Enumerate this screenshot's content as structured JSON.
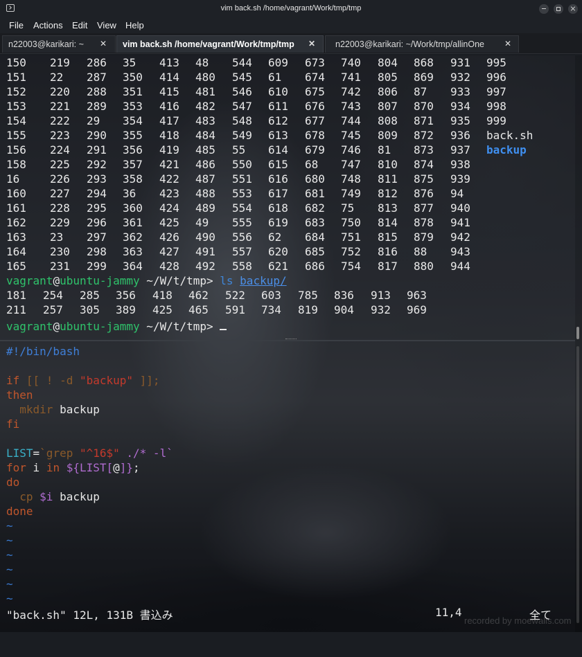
{
  "window": {
    "title": "vim back.sh /home/vagrant/Work/tmp/tmp"
  },
  "menu": [
    "File",
    "Actions",
    "Edit",
    "View",
    "Help"
  ],
  "tabs": [
    {
      "label": "n22003@karikari: ~",
      "active": false
    },
    {
      "label": "vim back.sh /home/vagrant/Work/tmp/tmp",
      "active": true
    },
    {
      "label": "n22003@karikari: ~/Work/tmp/allinOne",
      "active": false
    }
  ],
  "top_terminal": {
    "listing_rows": [
      [
        "150",
        "219",
        "286",
        "35",
        "413",
        "48",
        "544",
        "609",
        "673",
        "740",
        "804",
        "868",
        "931",
        "995"
      ],
      [
        "151",
        "22",
        "287",
        "350",
        "414",
        "480",
        "545",
        "61",
        "674",
        "741",
        "805",
        "869",
        "932",
        "996"
      ],
      [
        "152",
        "220",
        "288",
        "351",
        "415",
        "481",
        "546",
        "610",
        "675",
        "742",
        "806",
        "87",
        "933",
        "997"
      ],
      [
        "153",
        "221",
        "289",
        "353",
        "416",
        "482",
        "547",
        "611",
        "676",
        "743",
        "807",
        "870",
        "934",
        "998"
      ],
      [
        "154",
        "222",
        "29",
        "354",
        "417",
        "483",
        "548",
        "612",
        "677",
        "744",
        "808",
        "871",
        "935",
        "999"
      ],
      [
        "155",
        "223",
        "290",
        "355",
        "418",
        "484",
        "549",
        "613",
        "678",
        "745",
        "809",
        "872",
        "936",
        "back.sh"
      ],
      [
        "156",
        "224",
        "291",
        "356",
        "419",
        "485",
        "55",
        "614",
        "679",
        "746",
        "81",
        "873",
        "937",
        "backup"
      ],
      [
        "158",
        "225",
        "292",
        "357",
        "421",
        "486",
        "550",
        "615",
        "68",
        "747",
        "810",
        "874",
        "938",
        ""
      ],
      [
        "16",
        "226",
        "293",
        "358",
        "422",
        "487",
        "551",
        "616",
        "680",
        "748",
        "811",
        "875",
        "939",
        ""
      ],
      [
        "160",
        "227",
        "294",
        "36",
        "423",
        "488",
        "553",
        "617",
        "681",
        "749",
        "812",
        "876",
        "94",
        ""
      ],
      [
        "161",
        "228",
        "295",
        "360",
        "424",
        "489",
        "554",
        "618",
        "682",
        "75",
        "813",
        "877",
        "940",
        ""
      ],
      [
        "162",
        "229",
        "296",
        "361",
        "425",
        "49",
        "555",
        "619",
        "683",
        "750",
        "814",
        "878",
        "941",
        ""
      ],
      [
        "163",
        "23",
        "297",
        "362",
        "426",
        "490",
        "556",
        "62",
        "684",
        "751",
        "815",
        "879",
        "942",
        ""
      ],
      [
        "164",
        "230",
        "298",
        "363",
        "427",
        "491",
        "557",
        "620",
        "685",
        "752",
        "816",
        "88",
        "943",
        ""
      ],
      [
        "165",
        "231",
        "299",
        "364",
        "428",
        "492",
        "558",
        "621",
        "686",
        "754",
        "817",
        "880",
        "944",
        ""
      ]
    ],
    "prompt_user": "vagrant",
    "prompt_at": "@",
    "prompt_host": "ubuntu-jammy",
    "prompt_path": " ~/W/t/tmp",
    "prompt_symbol": "> ",
    "command": "ls",
    "command_arg": "backup/",
    "ls_output": [
      [
        "181",
        "254",
        "285",
        "356",
        "418",
        "462",
        "522",
        "603",
        "785",
        "836",
        "913",
        "963"
      ],
      [
        "211",
        "257",
        "305",
        "389",
        "425",
        "465",
        "591",
        "734",
        "819",
        "904",
        "932",
        "969"
      ]
    ]
  },
  "vim": {
    "lines": [
      [
        {
          "t": "#!/bin/bash",
          "c": "comment"
        }
      ],
      [],
      [
        {
          "t": "if",
          "c": "keyword"
        },
        {
          "t": " [[ ! -d ",
          "c": "dim"
        },
        {
          "t": "\"backup\"",
          "c": "string"
        },
        {
          "t": " ]];",
          "c": "dim"
        }
      ],
      [
        {
          "t": "then",
          "c": "keyword"
        }
      ],
      [
        {
          "t": "  mkdir",
          "c": "dim"
        },
        {
          "t": " backup",
          "c": "normal"
        }
      ],
      [
        {
          "t": "fi",
          "c": "keyword"
        }
      ],
      [],
      [
        {
          "t": "LIST",
          "c": "identifier"
        },
        {
          "t": "=",
          "c": "normal"
        },
        {
          "t": "`grep ",
          "c": "dim"
        },
        {
          "t": "\"^16$\"",
          "c": "string"
        },
        {
          "t": " ./* -l`",
          "c": "special"
        }
      ],
      [
        {
          "t": "for",
          "c": "keyword"
        },
        {
          "t": " i ",
          "c": "normal"
        },
        {
          "t": "in",
          "c": "keyword"
        },
        {
          "t": " ${LIST[",
          "c": "special"
        },
        {
          "t": "@",
          "c": "normal"
        },
        {
          "t": "]}",
          "c": "special"
        },
        {
          "t": ";",
          "c": "normal"
        }
      ],
      [
        {
          "t": "do",
          "c": "keyword"
        }
      ],
      [
        {
          "t": "  cp",
          "c": "dim"
        },
        {
          "t": " $i",
          "c": "special"
        },
        {
          "t": " backup",
          "c": "normal"
        }
      ],
      [
        {
          "t": "done",
          "c": "keyword"
        }
      ],
      [
        {
          "t": "~",
          "c": "tilde"
        }
      ],
      [
        {
          "t": "~",
          "c": "tilde"
        }
      ],
      [
        {
          "t": "~",
          "c": "tilde"
        }
      ],
      [
        {
          "t": "~",
          "c": "tilde"
        }
      ],
      [
        {
          "t": "~",
          "c": "tilde"
        }
      ],
      [
        {
          "t": "~",
          "c": "tilde"
        }
      ]
    ],
    "status_file": "\"back.sh\" 12L, 131B 書込み",
    "status_pos": "11,4",
    "status_scroll": "全て"
  },
  "watermark": "recorded by moewalls.com"
}
